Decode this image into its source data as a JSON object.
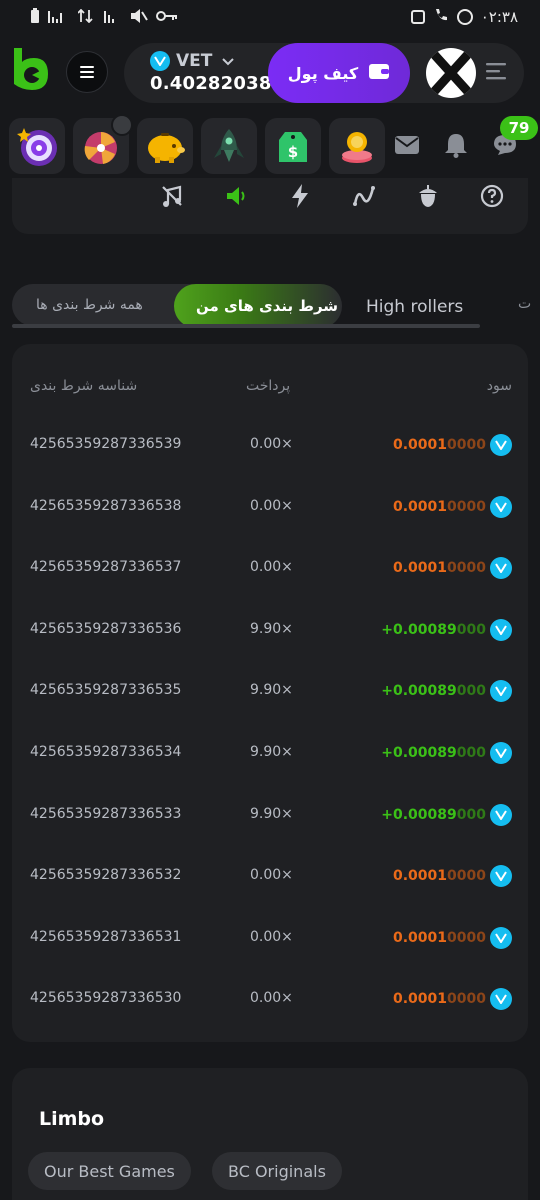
{
  "status_bar": {
    "time": "۰۲:۳۸"
  },
  "header": {
    "coin_symbol": "VET",
    "balance": "0.40282038",
    "wallet_label": "کیف پول"
  },
  "shortcuts": {
    "message_count": "79"
  },
  "tabs": {
    "all_bets": "همه شرط بندی ها",
    "my_bets": "شرط بندی های من",
    "high_rollers": "High rollers",
    "partial": "ت"
  },
  "table": {
    "headers": {
      "bet_id": "شناسه شرط بندی",
      "payout": "پرداخت",
      "profit": "سود"
    },
    "rows": [
      {
        "id": "42565359287336539",
        "payout": "0.00×",
        "profit_main": "0.0001",
        "profit_tail": "0000",
        "type": "neg"
      },
      {
        "id": "42565359287336538",
        "payout": "0.00×",
        "profit_main": "0.0001",
        "profit_tail": "0000",
        "type": "neg"
      },
      {
        "id": "42565359287336537",
        "payout": "0.00×",
        "profit_main": "0.0001",
        "profit_tail": "0000",
        "type": "neg"
      },
      {
        "id": "42565359287336536",
        "payout": "9.90×",
        "profit_main": "+0.00089",
        "profit_tail": "000",
        "type": "pos"
      },
      {
        "id": "42565359287336535",
        "payout": "9.90×",
        "profit_main": "+0.00089",
        "profit_tail": "000",
        "type": "pos"
      },
      {
        "id": "42565359287336534",
        "payout": "9.90×",
        "profit_main": "+0.00089",
        "profit_tail": "000",
        "type": "pos"
      },
      {
        "id": "42565359287336533",
        "payout": "9.90×",
        "profit_main": "+0.00089",
        "profit_tail": "000",
        "type": "pos"
      },
      {
        "id": "42565359287336532",
        "payout": "0.00×",
        "profit_main": "0.0001",
        "profit_tail": "0000",
        "type": "neg"
      },
      {
        "id": "42565359287336531",
        "payout": "0.00×",
        "profit_main": "0.0001",
        "profit_tail": "0000",
        "type": "neg"
      },
      {
        "id": "42565359287336530",
        "payout": "0.00×",
        "profit_main": "0.0001",
        "profit_tail": "0000",
        "type": "neg"
      }
    ]
  },
  "bottom": {
    "title": "Limbo",
    "chips": [
      "Our Best Games",
      "BC Originals"
    ]
  },
  "colors": {
    "accent_purple": "#7b2cf5",
    "accent_green": "#3bc117",
    "loss_orange": "#ea6a19",
    "vet_blue": "#15bdf0"
  }
}
